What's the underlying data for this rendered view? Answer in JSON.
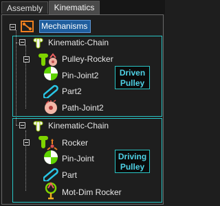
{
  "tabs": [
    {
      "label": "Assembly"
    },
    {
      "label": "Kinematics"
    }
  ],
  "tree": {
    "root": "Mechanisms",
    "group1": {
      "chain": "Kinematic-Chain",
      "items": [
        "Pulley-Rocker",
        "Pin-Joint2",
        "Part2",
        "Path-Joint2"
      ],
      "callout": [
        "Driven",
        "Pulley"
      ]
    },
    "group2": {
      "chain": "Kinematic-Chain",
      "items": [
        "Rocker",
        "Pin-Joint",
        "Part",
        "Mot-Dim Rocker"
      ],
      "callout": [
        "Driving",
        "Pulley"
      ]
    }
  },
  "colors": {
    "accent": "#29c6c6",
    "callout_text": "#4fd2e6",
    "selection": "#1f5e9e",
    "green": "#5fd400"
  },
  "icons": [
    "mechanisms-icon",
    "kinematic-chain-icon",
    "pulley-rocker-icon",
    "pin-joint-icon",
    "part-icon",
    "path-joint-icon",
    "rocker-icon",
    "motion-dimension-icon"
  ]
}
